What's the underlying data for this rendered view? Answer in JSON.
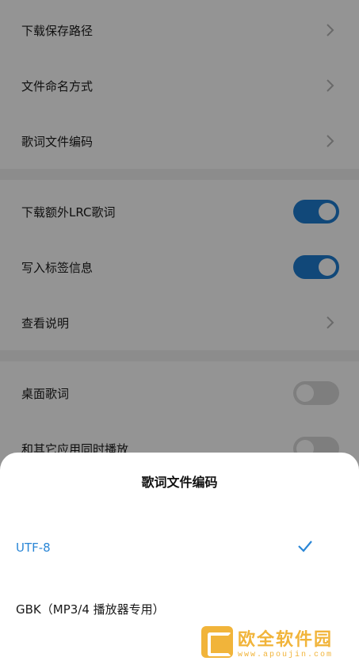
{
  "settings": {
    "rows": [
      {
        "label": "下载保存路径",
        "type": "chevron"
      },
      {
        "label": "文件命名方式",
        "type": "chevron"
      },
      {
        "label": "歌词文件编码",
        "type": "chevron"
      },
      {
        "label": "下载额外LRC歌词",
        "type": "toggle",
        "on": true
      },
      {
        "label": "写入标签信息",
        "type": "toggle",
        "on": true
      },
      {
        "label": "查看说明",
        "type": "chevron"
      },
      {
        "label": "桌面歌词",
        "type": "toggle",
        "on": false
      },
      {
        "label": "和其它应用同时播放",
        "type": "toggle",
        "on": false
      }
    ]
  },
  "sheet": {
    "title": "歌词文件编码",
    "options": [
      {
        "label": "UTF-8",
        "selected": true
      },
      {
        "label": "GBK（MP3/4 播放器专用）",
        "selected": false
      }
    ]
  },
  "watermark": {
    "title": "欧全软件园",
    "url": "www.apoujin.com"
  },
  "colors": {
    "accent": "#1e7dd1",
    "selected_text": "#2a86d6",
    "overlay": "rgba(0,0,0,0.42)",
    "watermark": "#f1b43a"
  },
  "icons": [
    "chevron-right-icon",
    "checkmark-icon",
    "watermark-logo-icon"
  ]
}
